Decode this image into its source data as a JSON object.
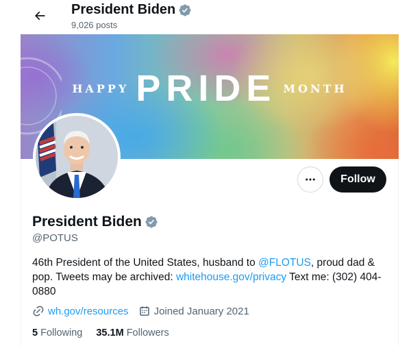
{
  "header": {
    "name": "President Biden",
    "posts": "9,026 posts"
  },
  "banner": {
    "left_text": "HAPPY",
    "center_text": "PRIDE",
    "right_text": "MONTH"
  },
  "actions": {
    "more_label": "More",
    "follow_label": "Follow"
  },
  "profile": {
    "name": "President Biden",
    "handle": "@POTUS",
    "bio_part1": "46th President of the United States, husband to ",
    "bio_mention": "@FLOTUS",
    "bio_part2": ", proud dad & pop. Tweets may be archived: ",
    "bio_link": "whitehouse.gov/privacy",
    "bio_part3": " Text me: (302) 404-0880",
    "website": "wh.gov/resources",
    "joined": "Joined January 2021"
  },
  "stats": {
    "following_count": "5",
    "following_label": "Following",
    "followers_count": "35.1M",
    "followers_label": "Followers"
  },
  "colors": {
    "accent": "#1d9bf0",
    "verified_badge": "#829aab",
    "text_primary": "#0f1419",
    "text_secondary": "#536471"
  },
  "icons": {
    "back": "arrow-left-icon",
    "verified": "verified-badge-icon",
    "more": "ellipsis-icon",
    "website": "link-icon",
    "joined": "calendar-icon"
  }
}
